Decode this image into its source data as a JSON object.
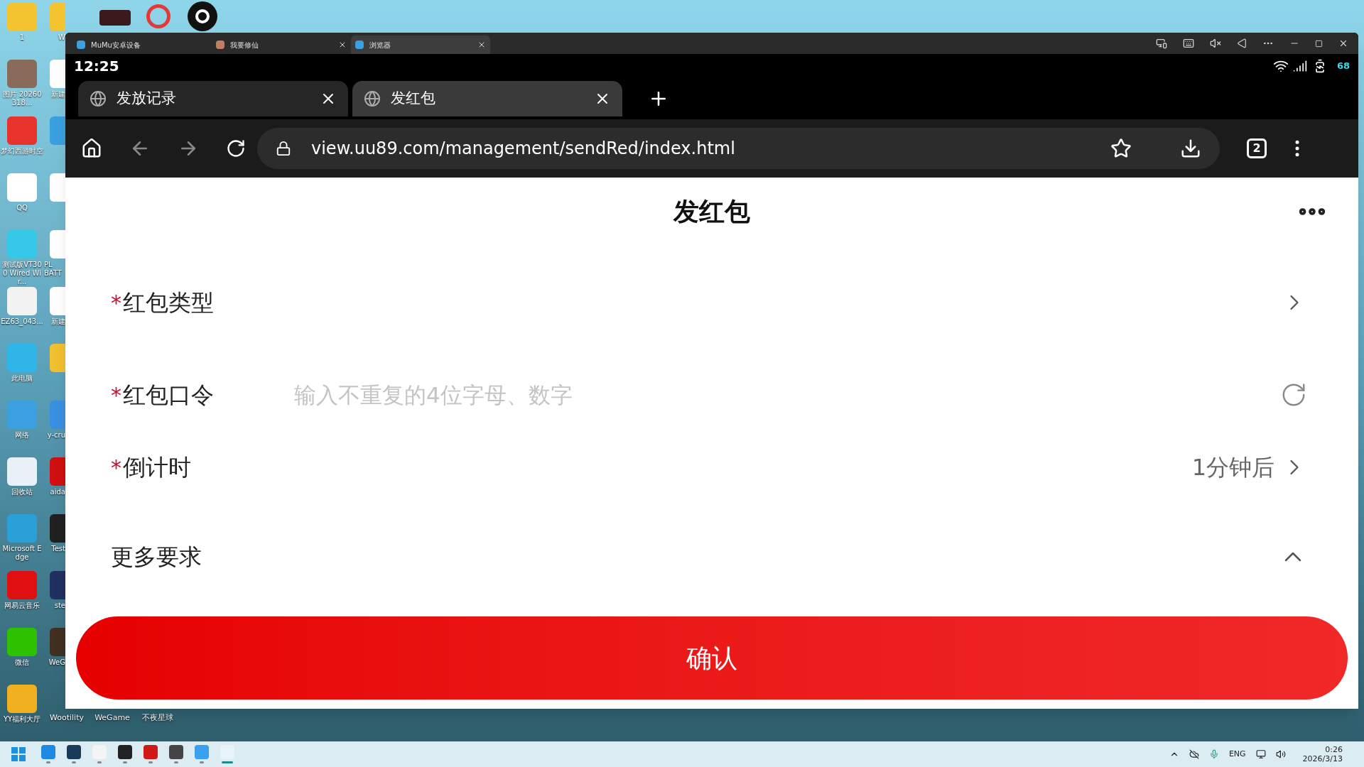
{
  "desktop": {
    "column_1": [
      "1",
      "图片 20260318...",
      "梦幻西游时空",
      "QQ",
      "测试版VT300 Wired Wir...",
      "EZ63_043...",
      "此电脑",
      "网络",
      "回收站",
      "Microsoft Edge",
      "网易云音乐",
      "微信",
      "YY福利大厅"
    ],
    "column_2": [
      {
        "kind": "labeled",
        "label": "W"
      },
      {
        "kind": "labeled",
        "label": "新建"
      },
      {
        "kind": "icon"
      },
      {
        "kind": "icon"
      },
      {
        "kind": "labeled",
        "label": "PL BATT"
      },
      {
        "kind": "labeled",
        "label": "新建"
      },
      {
        "kind": "icon"
      },
      {
        "kind": "labeled",
        "label": "y-cru"
      },
      {
        "kind": "labeled",
        "label": "aida"
      },
      {
        "kind": "labeled",
        "label": "Test"
      },
      {
        "kind": "labeled",
        "label": "ste"
      },
      {
        "kind": "labeled",
        "label": "WeG"
      }
    ],
    "bottom_row": [
      "Wootility",
      "WeGame",
      "不夜星球"
    ]
  },
  "emulator": {
    "tabs": [
      {
        "label": "MuMu安卓设备",
        "selected": false,
        "closable": false
      },
      {
        "label": "我要修仙",
        "selected": false,
        "closable": true
      },
      {
        "label": "浏览器",
        "selected": true,
        "closable": true
      }
    ]
  },
  "status_bar": {
    "time": "12:25",
    "battery_percent": "68"
  },
  "browser": {
    "tabs": [
      {
        "label": "发放记录",
        "selected": false
      },
      {
        "label": "发红包",
        "selected": true
      }
    ],
    "url": "view.uu89.com/management/sendRed/index.html",
    "tab_count": "2"
  },
  "page": {
    "title": "发红包",
    "required_mark": "*",
    "rows": [
      {
        "kind": "select",
        "label": "红包类型",
        "required": true
      },
      {
        "kind": "input",
        "label": "红包口令",
        "required": true,
        "placeholder": "输入不重复的4位字母、数字"
      },
      {
        "kind": "select",
        "label": "倒计时",
        "required": true,
        "value": "1分钟后"
      },
      {
        "kind": "toggle",
        "label": "更多要求",
        "required": false,
        "expanded": true
      }
    ],
    "confirm_button": "确认"
  },
  "taskbar": {
    "apps": [
      {
        "selected": false
      },
      {
        "selected": false
      },
      {
        "selected": false
      },
      {
        "selected": false
      },
      {
        "selected": false
      },
      {
        "selected": false
      },
      {
        "selected": false
      },
      {
        "selected": true
      }
    ],
    "language": "ENG",
    "time": "0:26",
    "date": "2026/3/13"
  }
}
